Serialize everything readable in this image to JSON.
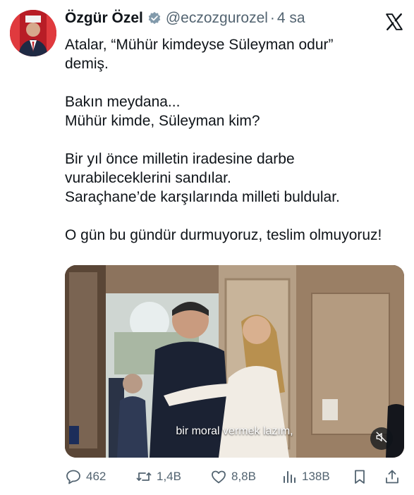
{
  "tweet": {
    "author_name": "Özgür Özel",
    "handle": "@eczozgurozel",
    "separator": "·",
    "time": "4 sa",
    "lines": [
      "Atalar, “Mühür kimdeyse Süleyman odur”",
      "demiş.",
      "",
      "Bakın meydana...",
      "Mühür kimde, Süleyman kim?",
      "",
      "Bir yıl önce milletin iradesine darbe",
      "vurabileceklerini sandılar.",
      "Saraçhane’de karşılarında milleti buldular.",
      "",
      "O gün bu gündür durmuyoruz, teslim olmuyoruz!"
    ]
  },
  "video": {
    "subtitle": "bir moral vermek lazım,",
    "mute_icon": "speaker-muted-icon"
  },
  "actions": {
    "replies": "462",
    "reposts": "1,4B",
    "likes": "8,8B",
    "views": "138B"
  },
  "colors": {
    "text": "#0f1419",
    "secondary": "#536471",
    "verified": "#829aab",
    "avatar_bg": "#c7202b"
  }
}
